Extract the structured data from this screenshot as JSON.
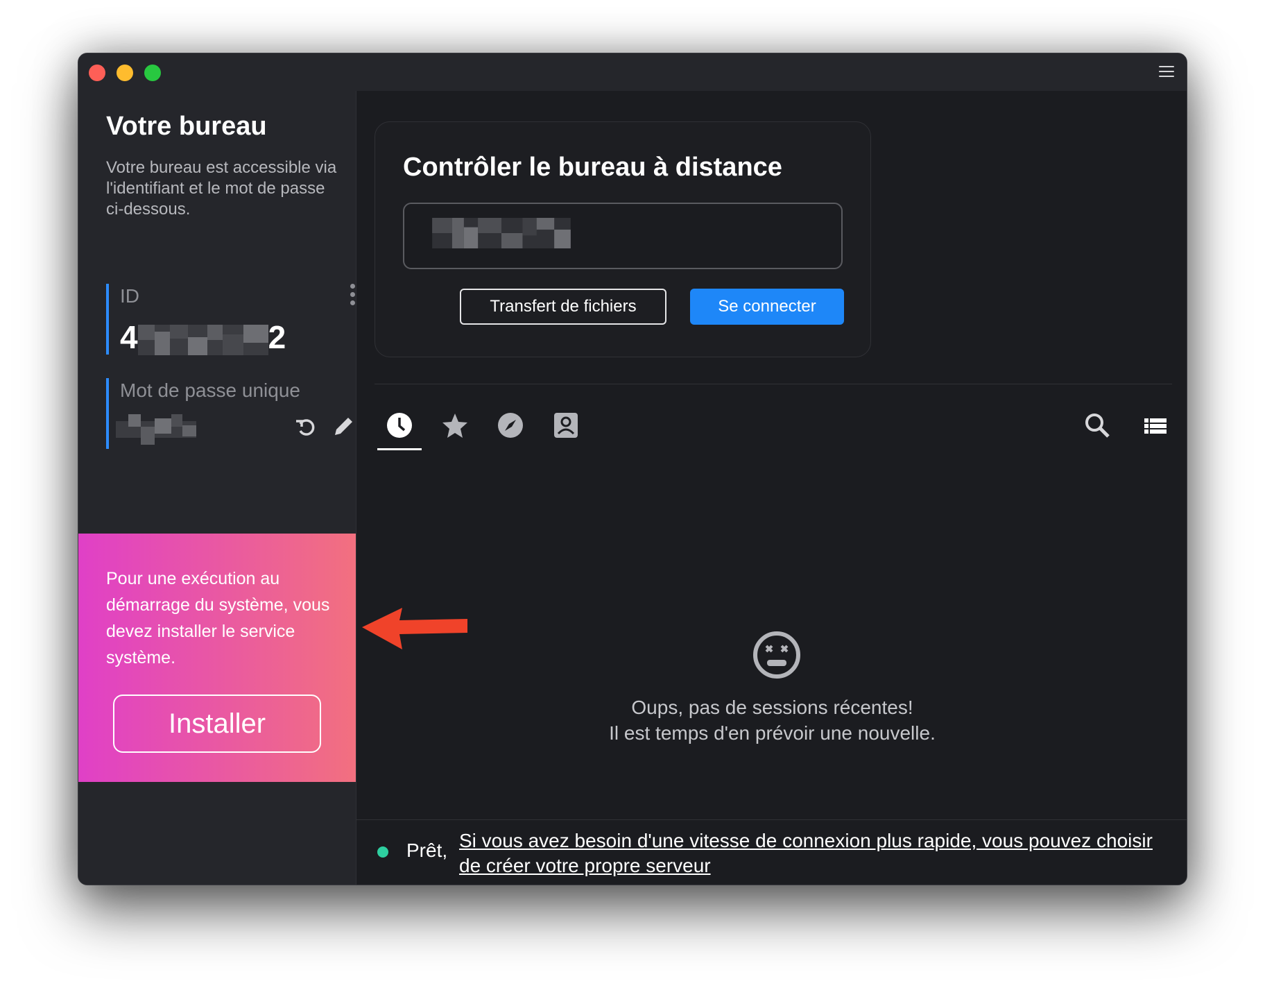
{
  "window": {
    "title_lights": [
      "close",
      "minimize",
      "zoom"
    ],
    "menu_icon": "hamburger-menu-icon"
  },
  "sidebar": {
    "title": "Votre bureau",
    "description": "Votre bureau est accessible via l'identifiant et le mot de passe ci-dessous.",
    "id_label": "ID",
    "id_first_digit": "4",
    "id_last_digit": "2",
    "password_label": "Mot de passe unique",
    "refresh_icon": "refresh-icon",
    "edit_icon": "pencil-icon"
  },
  "promo": {
    "text": "Pour une exécution au démarrage du système, vous devez installer le service système.",
    "button_label": "Installer",
    "gradient_start": "#e040c7",
    "gradient_end": "#f2707f"
  },
  "remote": {
    "title": "Contrôler le bureau à distance",
    "file_transfer_label": "Transfert de fichiers",
    "connect_label": "Se connecter",
    "accent": "#1e87f8"
  },
  "tabs": [
    {
      "name": "recent",
      "icon": "clock-icon",
      "active": true
    },
    {
      "name": "favorites",
      "icon": "star-icon",
      "active": false
    },
    {
      "name": "discovered",
      "icon": "compass-icon",
      "active": false
    },
    {
      "name": "address-book",
      "icon": "contact-card-icon",
      "active": false
    }
  ],
  "toolbar_icons": [
    "search-icon",
    "list-view-icon"
  ],
  "empty_state": {
    "icon": "dizzy-face-icon",
    "line1": "Oups, pas de sessions récentes!",
    "line2": "Il est temps d'en prévoir une nouvelle."
  },
  "status": {
    "ready": "Prêt,",
    "link": "Si vous avez besoin d'une vitesse de connexion plus rapide, vous pouvez choisir de créer votre propre serveur",
    "dot_color": "#2ecfa0"
  },
  "annotation_arrow_color": "#f0432a"
}
